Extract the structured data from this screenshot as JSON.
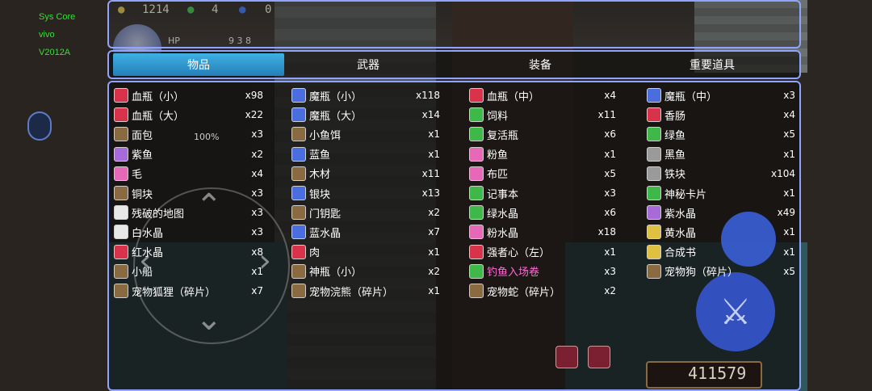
{
  "system_info": [
    "Sys Core",
    "vivo",
    "V2012A"
  ],
  "status_bar": {
    "coins": "1214",
    "green_count": "4",
    "blue_count": "0"
  },
  "hp": {
    "label": "HP",
    "value": "9 3 8"
  },
  "percent": "100%",
  "gold": "411579",
  "tabs": [
    "物品",
    "武器",
    "装备",
    "重要道具"
  ],
  "active_tab": 0,
  "colors": {
    "tab_active": "#2a8ad0",
    "frame": "#8fa4ff",
    "highlight_item": "#ff6ad8",
    "bg": "#000000"
  },
  "items": [
    [
      {
        "name": "血瓶（小）",
        "count": "x98",
        "icon": "red-potion-icon"
      },
      {
        "name": "血瓶（大）",
        "count": "x22",
        "icon": "big-red-potion-icon"
      },
      {
        "name": "面包",
        "count": "x3",
        "icon": "bread-icon"
      },
      {
        "name": "紫鱼",
        "count": "x2",
        "icon": "purple-fish-icon"
      },
      {
        "name": "毛",
        "count": "x4",
        "icon": "fur-icon"
      },
      {
        "name": "铜块",
        "count": "x3",
        "icon": "copper-icon"
      },
      {
        "name": "残破的地图",
        "count": "x3",
        "icon": "map-icon"
      },
      {
        "name": "白水晶",
        "count": "x3",
        "icon": "white-crystal-icon"
      },
      {
        "name": "红水晶",
        "count": "x8",
        "icon": "red-crystal-icon"
      },
      {
        "name": "小船",
        "count": "x1",
        "icon": "boat-icon"
      },
      {
        "name": "宠物狐狸（碎片）",
        "count": "x7",
        "icon": "fox-icon"
      }
    ],
    [
      {
        "name": "魔瓶（小）",
        "count": "x118",
        "icon": "blue-potion-icon"
      },
      {
        "name": "魔瓶（大）",
        "count": "x14",
        "icon": "big-blue-potion-icon"
      },
      {
        "name": "小鱼饵",
        "count": "x1",
        "icon": "bait-icon"
      },
      {
        "name": "蓝鱼",
        "count": "x1",
        "icon": "blue-fish-icon"
      },
      {
        "name": "木材",
        "count": "x11",
        "icon": "wood-icon"
      },
      {
        "name": "银块",
        "count": "x13",
        "icon": "silver-icon"
      },
      {
        "name": "门钥匙",
        "count": "x2",
        "icon": "key-icon"
      },
      {
        "name": "蓝水晶",
        "count": "x7",
        "icon": "blue-crystal-icon"
      },
      {
        "name": "肉",
        "count": "x1",
        "icon": "meat-icon"
      },
      {
        "name": "神瓶（小）",
        "count": "x2",
        "icon": "holy-potion-icon"
      },
      {
        "name": "宠物浣熊（碎片）",
        "count": "x1",
        "icon": "raccoon-icon"
      }
    ],
    [
      {
        "name": "血瓶（中）",
        "count": "x4",
        "icon": "mid-red-potion-icon"
      },
      {
        "name": "饲料",
        "count": "x11",
        "icon": "feed-icon"
      },
      {
        "name": "复活瓶",
        "count": "x6",
        "icon": "revive-potion-icon"
      },
      {
        "name": "粉鱼",
        "count": "x1",
        "icon": "pink-fish-icon"
      },
      {
        "name": "布匹",
        "count": "x5",
        "icon": "cloth-icon"
      },
      {
        "name": "记事本",
        "count": "x3",
        "icon": "notebook-icon"
      },
      {
        "name": "绿水晶",
        "count": "x6",
        "icon": "green-crystal-icon"
      },
      {
        "name": "粉水晶",
        "count": "x18",
        "icon": "pink-crystal-icon"
      },
      {
        "name": "强者心（左）",
        "count": "x1",
        "icon": "heart-icon"
      },
      {
        "name": "钓鱼入场卷",
        "count": "x3",
        "icon": "fishing-ticket-icon",
        "highlight": true
      },
      {
        "name": "宠物蛇（碎片）",
        "count": "x2",
        "icon": "snake-icon"
      }
    ],
    [
      {
        "name": "魔瓶（中）",
        "count": "x3",
        "icon": "mid-blue-potion-icon"
      },
      {
        "name": "香肠",
        "count": "x4",
        "icon": "sausage-icon"
      },
      {
        "name": "绿鱼",
        "count": "x5",
        "icon": "green-fish-icon"
      },
      {
        "name": "黑鱼",
        "count": "x1",
        "icon": "black-fish-icon"
      },
      {
        "name": "铁块",
        "count": "x104",
        "icon": "iron-icon"
      },
      {
        "name": "神秘卡片",
        "count": "x1",
        "icon": "card-icon"
      },
      {
        "name": "紫水晶",
        "count": "x49",
        "icon": "purple-crystal-icon"
      },
      {
        "name": "黄水晶",
        "count": "x1",
        "icon": "yellow-crystal-icon"
      },
      {
        "name": "合成书",
        "count": "x1",
        "icon": "book-icon"
      },
      {
        "name": "宠物狗（碎片）",
        "count": "x5",
        "icon": "dog-icon"
      }
    ]
  ]
}
